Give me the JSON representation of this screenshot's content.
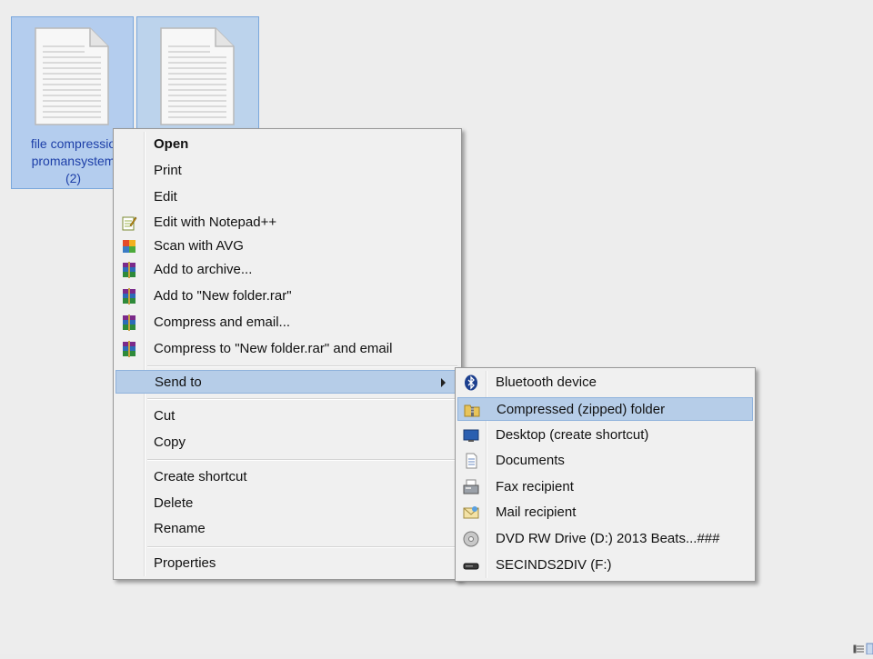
{
  "files": [
    {
      "label_lines": [
        "file compressio",
        "promansystem",
        "(2)"
      ]
    },
    {
      "label_lines": []
    }
  ],
  "context_menu": {
    "items": [
      {
        "label": "Open",
        "bold": true,
        "icon": ""
      },
      {
        "label": "Print",
        "icon": ""
      },
      {
        "label": "Edit",
        "icon": ""
      },
      {
        "label": "Edit with Notepad++",
        "icon": "notepad-icon"
      },
      {
        "label": "Scan with AVG",
        "icon": "avg-icon"
      },
      {
        "label": "Add to archive...",
        "icon": "winrar-icon"
      },
      {
        "label": "Add to \"New folder.rar\"",
        "icon": "winrar-icon"
      },
      {
        "label": "Compress and email...",
        "icon": "winrar-icon"
      },
      {
        "label": "Compress to \"New folder.rar\" and email",
        "icon": "winrar-icon"
      },
      {
        "label": "Send to",
        "icon": "",
        "submenu": true
      },
      {
        "label": "Cut",
        "icon": ""
      },
      {
        "label": "Copy",
        "icon": ""
      },
      {
        "label": "Create shortcut",
        "icon": ""
      },
      {
        "label": "Delete",
        "icon": ""
      },
      {
        "label": "Rename",
        "icon": ""
      },
      {
        "label": "Properties",
        "icon": ""
      }
    ]
  },
  "send_to_menu": {
    "items": [
      {
        "label": "Bluetooth device",
        "icon": "bluetooth-icon"
      },
      {
        "label": "Compressed (zipped) folder",
        "icon": "zip-folder-icon"
      },
      {
        "label": "Desktop (create shortcut)",
        "icon": "desktop-icon"
      },
      {
        "label": "Documents",
        "icon": "documents-icon"
      },
      {
        "label": "Fax recipient",
        "icon": "fax-icon"
      },
      {
        "label": "Mail recipient",
        "icon": "mail-icon"
      },
      {
        "label": "DVD RW Drive (D:) 2013 Beats...###",
        "icon": "dvd-icon"
      },
      {
        "label": "SECINDS2DIV (F:)",
        "icon": "drive-icon"
      }
    ]
  },
  "colors": {
    "selection": "#b4cdee",
    "menu_highlight": "#b6cde8",
    "file_label": "#1d3fa8"
  }
}
